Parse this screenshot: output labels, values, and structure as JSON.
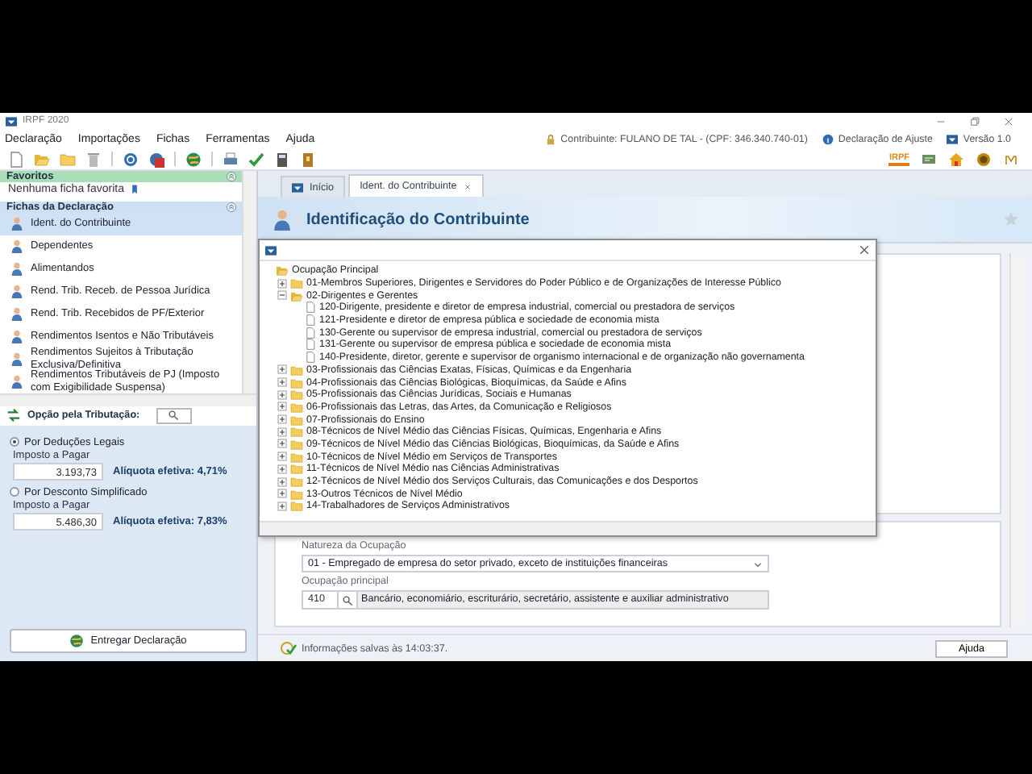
{
  "window": {
    "title": "IRPF 2020"
  },
  "menu": [
    "Declaração",
    "Importações",
    "Fichas",
    "Ferramentas",
    "Ajuda"
  ],
  "header_info": {
    "contribuinte": "Contribuinte: FULANO DE TAL - (CPF: 346.340.740-01)",
    "declaration_type": "Declaração de Ajuste",
    "version": "Versão 1.0"
  },
  "toolbar_logo": "IRPF",
  "sidebar": {
    "favorites": {
      "title": "Favoritos",
      "empty_text": "Nenhuma ficha favorita"
    },
    "fichas": {
      "title": "Fichas da Declaração",
      "items": [
        {
          "label": "Ident. do Contribuinte",
          "selected": true
        },
        {
          "label": "Dependentes",
          "selected": false
        },
        {
          "label": "Alimentandos",
          "selected": false
        },
        {
          "label": "Rend. Trib. Receb. de Pessoa Jurídica",
          "selected": false
        },
        {
          "label": "Rend. Trib. Recebidos de PF/Exterior",
          "selected": false
        },
        {
          "label": "Rendimentos Isentos e Não Tributáveis",
          "selected": false
        },
        {
          "label": "Rendimentos Sujeitos à Tributação Exclusiva/Definitiva",
          "selected": false
        },
        {
          "label": "Rendimentos Tributáveis de PJ (Imposto com Exigibilidade Suspensa)",
          "selected": false
        }
      ]
    }
  },
  "tributacao": {
    "title": "Opção pela Tributação:",
    "options": [
      {
        "label": "Por Deduções Legais",
        "selected": true,
        "amount_label": "Imposto a Pagar",
        "amount": "3.193,73",
        "rate": "Alíquota efetiva: 4,71%"
      },
      {
        "label": "Por Desconto Simplificado",
        "selected": false,
        "amount_label": "Imposto a Pagar",
        "amount": "5.486,30",
        "rate": "Alíquota efetiva: 7,83%"
      }
    ],
    "submit": "Entregar Declaração"
  },
  "tabs": [
    {
      "label": "Início",
      "selected": false,
      "closable": false
    },
    {
      "label": "Ident. do Contribuinte",
      "selected": true,
      "closable": true
    }
  ],
  "page_title": "Identificação do Contribuinte",
  "dialog": {
    "tree": [
      {
        "kind": "folder",
        "label": "Ocupação Principal",
        "expanded": true,
        "children": [
          {
            "kind": "folder",
            "label": "01-Membros Superiores, Dirigentes e Servidores do Poder Público e de Organizações de Interesse Público",
            "expanded": false
          },
          {
            "kind": "folder",
            "label": "02-Dirigentes e Gerentes",
            "expanded": true,
            "children": [
              {
                "kind": "item",
                "label": "120-Dirigente, presidente e diretor de empresa industrial, comercial ou prestadora de serviços"
              },
              {
                "kind": "item",
                "label": "121-Presidente e diretor de empresa pública e sociedade de economia mista"
              },
              {
                "kind": "item",
                "label": "130-Gerente ou supervisor de empresa industrial, comercial ou prestadora de serviços"
              },
              {
                "kind": "item",
                "label": "131-Gerente ou supervisor de empresa pública e sociedade de economia mista"
              },
              {
                "kind": "item",
                "label": "140-Presidente, diretor, gerente e supervisor de organismo internacional e de organização não governamenta"
              }
            ]
          },
          {
            "kind": "folder",
            "label": "03-Profissionais das Ciências Exatas, Físicas, Químicas e da Engenharia",
            "expanded": false
          },
          {
            "kind": "folder",
            "label": "04-Profissionais das Ciências Biológicas, Bioquímicas, da Saúde e Afins",
            "expanded": false
          },
          {
            "kind": "folder",
            "label": "05-Profissionais das Ciências Jurídicas, Sociais e Humanas",
            "expanded": false
          },
          {
            "kind": "folder",
            "label": "06-Profissionais das Letras, das Artes, da Comunicação e Religiosos",
            "expanded": false
          },
          {
            "kind": "folder",
            "label": "07-Profissionais do Ensino",
            "expanded": false
          },
          {
            "kind": "folder",
            "label": "08-Técnicos de Nível Médio das Ciências Físicas, Químicas, Engenharia e Afins",
            "expanded": false
          },
          {
            "kind": "folder",
            "label": "09-Técnicos de Nível Médio das Ciências Biológicas, Bioquímicas, da Saúde e Afins",
            "expanded": false
          },
          {
            "kind": "folder",
            "label": "10-Técnicos de Nível Médio em Serviços de Transportes",
            "expanded": false
          },
          {
            "kind": "folder",
            "label": "11-Técnicos de Nível Médio nas Ciências Administrativas",
            "expanded": false
          },
          {
            "kind": "folder",
            "label": "12-Técnicos de Nível Médio dos Serviços Culturais, das Comunicações e dos Desportos",
            "expanded": false
          },
          {
            "kind": "folder",
            "label": "13-Outros Técnicos de Nível Médio",
            "expanded": false
          },
          {
            "kind": "folder",
            "label": "14-Trabalhadores de Serviços Administrativos",
            "expanded": false
          }
        ]
      }
    ]
  },
  "form": {
    "natureza_label": "Natureza da Ocupação",
    "natureza_value": "01 - Empregado de empresa do setor privado, exceto de instituições financeiras",
    "ocupacao_label": "Ocupação principal",
    "ocupacao_code": "410",
    "ocupacao_desc": "Bancário, economiário, escriturário, secretário, assistente e auxiliar administrativo"
  },
  "status_bar": {
    "message": "Informações salvas às 14:03:37.",
    "help_button": "Ajuda"
  }
}
